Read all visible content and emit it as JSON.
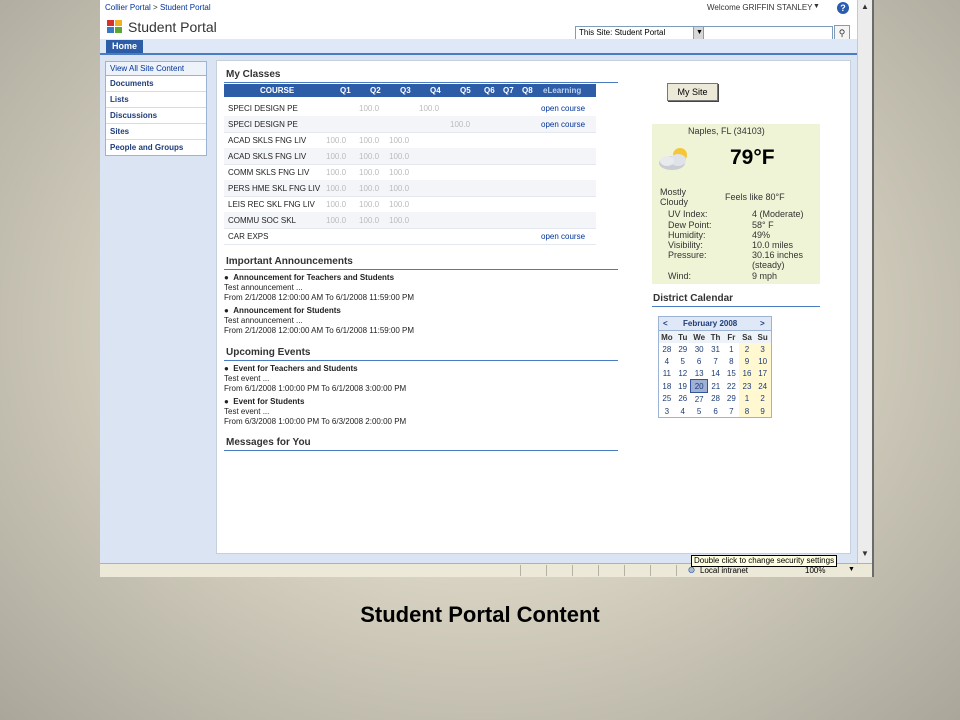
{
  "header": {
    "breadcrumb": [
      "Collier Portal",
      "Student Portal"
    ],
    "breadcrumb_sep": ">",
    "welcome": "Welcome GRIFFIN STANLEY",
    "portal_title": "Student Portal",
    "site_scope": "This Site: Student Portal",
    "home_tab": "Home"
  },
  "quick_launch": {
    "view_all": "View All Site Content",
    "items": [
      "Documents",
      "Lists",
      "Discussions",
      "Sites",
      "People and Groups"
    ]
  },
  "my_classes": {
    "title": "My Classes",
    "columns": [
      "COURSE",
      "Q1",
      "Q2",
      "Q3",
      "Q4",
      "Q5",
      "Q6",
      "Q7",
      "Q8",
      "eLearning"
    ],
    "rows": [
      {
        "course": "SPECI DESIGN PE",
        "grades": [
          "",
          "100.0",
          "",
          "100.0",
          "",
          "",
          "",
          ""
        ],
        "elearning": "open course"
      },
      {
        "course": "SPECI DESIGN PE",
        "grades": [
          "",
          "",
          "",
          "",
          "100.0",
          "",
          "",
          ""
        ],
        "elearning": "open course"
      },
      {
        "course": "ACAD SKLS FNG LIV",
        "grades": [
          "100.0",
          "100.0",
          "100.0",
          "",
          "",
          "",
          "",
          ""
        ],
        "elearning": ""
      },
      {
        "course": "ACAD SKLS FNG LIV",
        "grades": [
          "100.0",
          "100.0",
          "100.0",
          "",
          "",
          "",
          "",
          ""
        ],
        "elearning": ""
      },
      {
        "course": "COMM SKLS FNG LIV",
        "grades": [
          "100.0",
          "100.0",
          "100.0",
          "",
          "",
          "",
          "",
          ""
        ],
        "elearning": ""
      },
      {
        "course": "PERS HME SKL FNG LIV",
        "grades": [
          "100.0",
          "100.0",
          "100.0",
          "",
          "",
          "",
          "",
          ""
        ],
        "elearning": ""
      },
      {
        "course": "LEIS REC SKL FNG LIV",
        "grades": [
          "100.0",
          "100.0",
          "100.0",
          "",
          "",
          "",
          "",
          ""
        ],
        "elearning": ""
      },
      {
        "course": "COMMU SOC SKL",
        "grades": [
          "100.0",
          "100.0",
          "100.0",
          "",
          "",
          "",
          "",
          ""
        ],
        "elearning": ""
      },
      {
        "course": "CAR EXPS",
        "grades": [
          "",
          "",
          "",
          "",
          "",
          "",
          "",
          ""
        ],
        "elearning": "open course"
      }
    ]
  },
  "announcements": {
    "title": "Important Announcements",
    "items": [
      {
        "title": "Announcement for Teachers and Students",
        "body": "Test announcement ...",
        "dates": "From 2/1/2008 12:00:00 AM To 6/1/2008 11:59:00 PM"
      },
      {
        "title": "Announcement for Students",
        "body": "Test announcement ...",
        "dates": "From 2/1/2008 12:00:00 AM To 6/1/2008 11:59:00 PM"
      }
    ]
  },
  "events": {
    "title": "Upcoming Events",
    "items": [
      {
        "title": "Event for Teachers and Students",
        "body": "Test event ...",
        "dates": "From 6/1/2008 1:00:00 PM To 6/1/2008 3:00:00 PM"
      },
      {
        "title": "Event for Students",
        "body": "Test event ...",
        "dates": "From 6/3/2008 1:00:00 PM To 6/3/2008 2:00:00 PM"
      }
    ]
  },
  "messages": {
    "title": "Messages for You"
  },
  "my_site_button": "My Site",
  "weather": {
    "city": "Naples, FL (34103)",
    "temp": "79°F",
    "condition_1": "Mostly",
    "condition_2": "Cloudy",
    "feels_like": "Feels like 80°F",
    "details": [
      {
        "label": "UV Index:",
        "value": "4 (Moderate)"
      },
      {
        "label": "Dew Point:",
        "value": "58° F"
      },
      {
        "label": "Humidity:",
        "value": "49%"
      },
      {
        "label": "Visibility:",
        "value": "10.0 miles"
      },
      {
        "label": "Pressure:",
        "value": "30.16 inches"
      },
      {
        "label": "",
        "value": "(steady)"
      },
      {
        "label": "Wind:",
        "value": "9 mph"
      }
    ]
  },
  "calendar": {
    "title": "District Calendar",
    "month": "February 2008",
    "prev": "<",
    "next": ">",
    "days": [
      "Mo",
      "Tu",
      "We",
      "Th",
      "Fr",
      "Sa",
      "Su"
    ],
    "weeks": [
      [
        "28",
        "29",
        "30",
        "31",
        "1",
        "2",
        "3"
      ],
      [
        "4",
        "5",
        "6",
        "7",
        "8",
        "9",
        "10"
      ],
      [
        "11",
        "12",
        "13",
        "14",
        "15",
        "16",
        "17"
      ],
      [
        "18",
        "19",
        "20",
        "21",
        "22",
        "23",
        "24"
      ],
      [
        "25",
        "26",
        "27",
        "28",
        "29",
        "1",
        "2"
      ],
      [
        "3",
        "4",
        "5",
        "6",
        "7",
        "8",
        "9"
      ]
    ],
    "today": "20"
  },
  "status": {
    "tooltip": "Double click to change security settings",
    "zone": "Local intranet",
    "zoom": "100%"
  },
  "caption": "Student Portal Content",
  "colors": {
    "accent": "#2e5da8",
    "link": "#003399",
    "weather_bg": "#eef4d5"
  }
}
